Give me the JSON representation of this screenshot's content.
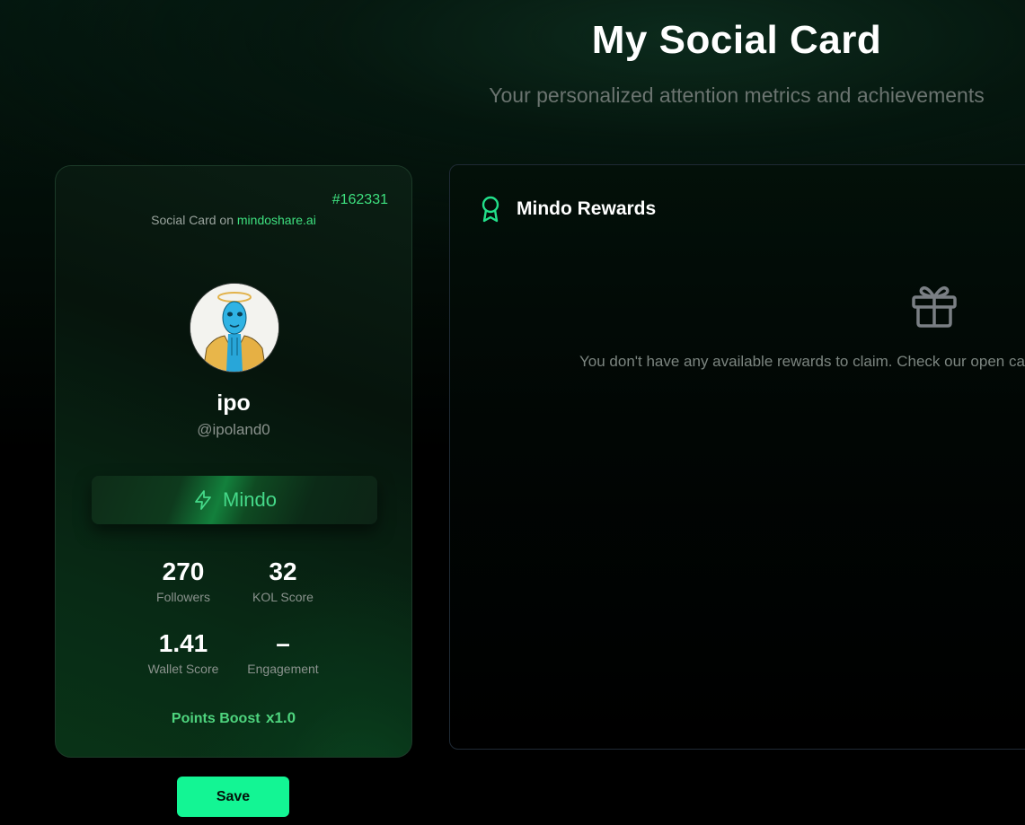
{
  "header": {
    "title": "My Social Card",
    "subtitle": "Your personalized attention metrics and achievements"
  },
  "card": {
    "id": "#162331",
    "source_prefix": "Social Card on",
    "source_brand": "mindoshare.ai",
    "display_name": "ipo",
    "handle": "@ipoland0",
    "tier": "Mindo",
    "stats": [
      {
        "value": "270",
        "label": "Followers"
      },
      {
        "value": "32",
        "label": "KOL Score"
      },
      {
        "value": "1.41",
        "label": "Wallet Score"
      },
      {
        "value": "–",
        "label": "Engagement"
      }
    ],
    "points_boost_label": "Points Boost",
    "points_boost_multiplier": "x1.0"
  },
  "save_label": "Save",
  "rewards": {
    "title": "Mindo Rewards",
    "empty_message": "You don't have any available rewards to claim. Check our open ca"
  },
  "colors": {
    "accent": "#3ee07f",
    "save_button": "#13f594",
    "tier_text": "#45d989"
  },
  "icons": {
    "tier": "lightning-bolt-icon",
    "rewards": "award-ribbon-icon",
    "empty_state": "gift-icon"
  }
}
